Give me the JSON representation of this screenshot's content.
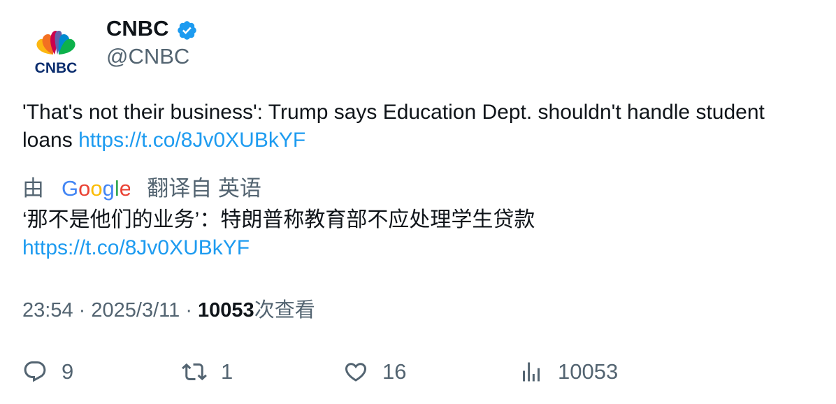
{
  "author": {
    "name": "CNBC",
    "handle": "@CNBC",
    "logo_text": "CNBC",
    "verified": true
  },
  "tweet": {
    "text": "'That's not their business': Trump says Education Dept. shouldn't handle student loans",
    "link": "https://t.co/8Jv0XUBkYF"
  },
  "translation": {
    "prefix": "由",
    "provider": "Google",
    "suffix": "翻译自 英语",
    "text": "‘那不是他们的业务’：特朗普称教育部不应处理学生贷款",
    "link": "https://t.co/8Jv0XUBkYF"
  },
  "meta": {
    "time": "23:54",
    "separator": "·",
    "date": "2025/3/11",
    "views_count": "10053",
    "views_label": "次查看"
  },
  "actions": {
    "replies": "9",
    "retweets": "1",
    "likes": "16",
    "views": "10053"
  },
  "colors": {
    "link": "#1d9bf0",
    "secondary_text": "#536471",
    "primary_text": "#0f1419",
    "verified": "#1d9bf0"
  }
}
